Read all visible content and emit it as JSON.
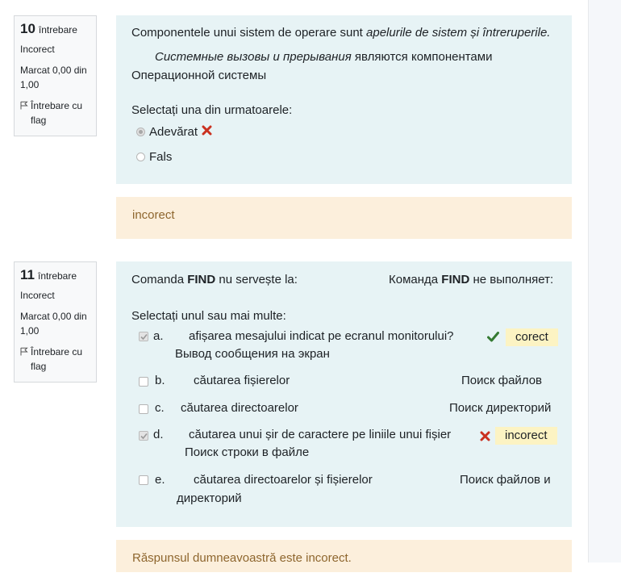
{
  "q10": {
    "number": "10",
    "word": "întrebare",
    "state": "Incorect",
    "grade": "Marcat 0,00 din 1,00",
    "flag": "Întrebare cu flag",
    "text_pre": "Componentele unui sistem de operare sunt ",
    "text_em": "apelurile de sistem și întreruperile.",
    "ru_em": "Системные вызовы и прерывания",
    "ru_rest": " являются компонентами",
    "ru_line2": "Операционной системы",
    "prompt": "Selectați una din urmatoarele:",
    "options": [
      "Adevărat",
      "Fals"
    ],
    "feedback": "incorect"
  },
  "q11": {
    "number": "11",
    "word": "întrebare",
    "state": "Incorect",
    "grade": "Marcat 0,00 din 1,00",
    "flag": "Întrebare cu flag",
    "cmd_pre": "Comanda ",
    "cmd_bold": "FIND",
    "cmd_post": " nu servește la:",
    "ru_pre": "Команда ",
    "ru_bold": "FIND",
    "ru_post": " не выполняет:",
    "prompt": "Selectați unul sau mai multe:",
    "options": [
      {
        "letter": "a.",
        "ro": "afișarea mesajului indicat pe ecranul monitorului?",
        "ru": "Вывод сообщения на экран",
        "badge": "corect"
      },
      {
        "letter": "b.",
        "ro": "căutarea fișierelor",
        "ru": "Поиск файлов"
      },
      {
        "letter": "c.",
        "ro": "căutarea directoarelor",
        "ru": "Поиск директорий"
      },
      {
        "letter": "d.",
        "ro": "căutarea unui șir de caractere pe liniile unui fișier",
        "ru": "Поиск строки в файле",
        "badge": "incorect"
      },
      {
        "letter": "e.",
        "ro": "căutarea directoarelor și fișierelor",
        "ru": "Поиск файлов и",
        "ru2": "директорий"
      }
    ],
    "feedback": "Răspunsul dumneavoastră este incorect."
  },
  "colors": {
    "content_bg": "#e7f3f5",
    "feedback_bg": "#fcefdc",
    "feedback_text": "#8e662e",
    "correct": "#357a32",
    "incorrect": "#ca3120",
    "badge_bg": "#fcf3c3"
  }
}
